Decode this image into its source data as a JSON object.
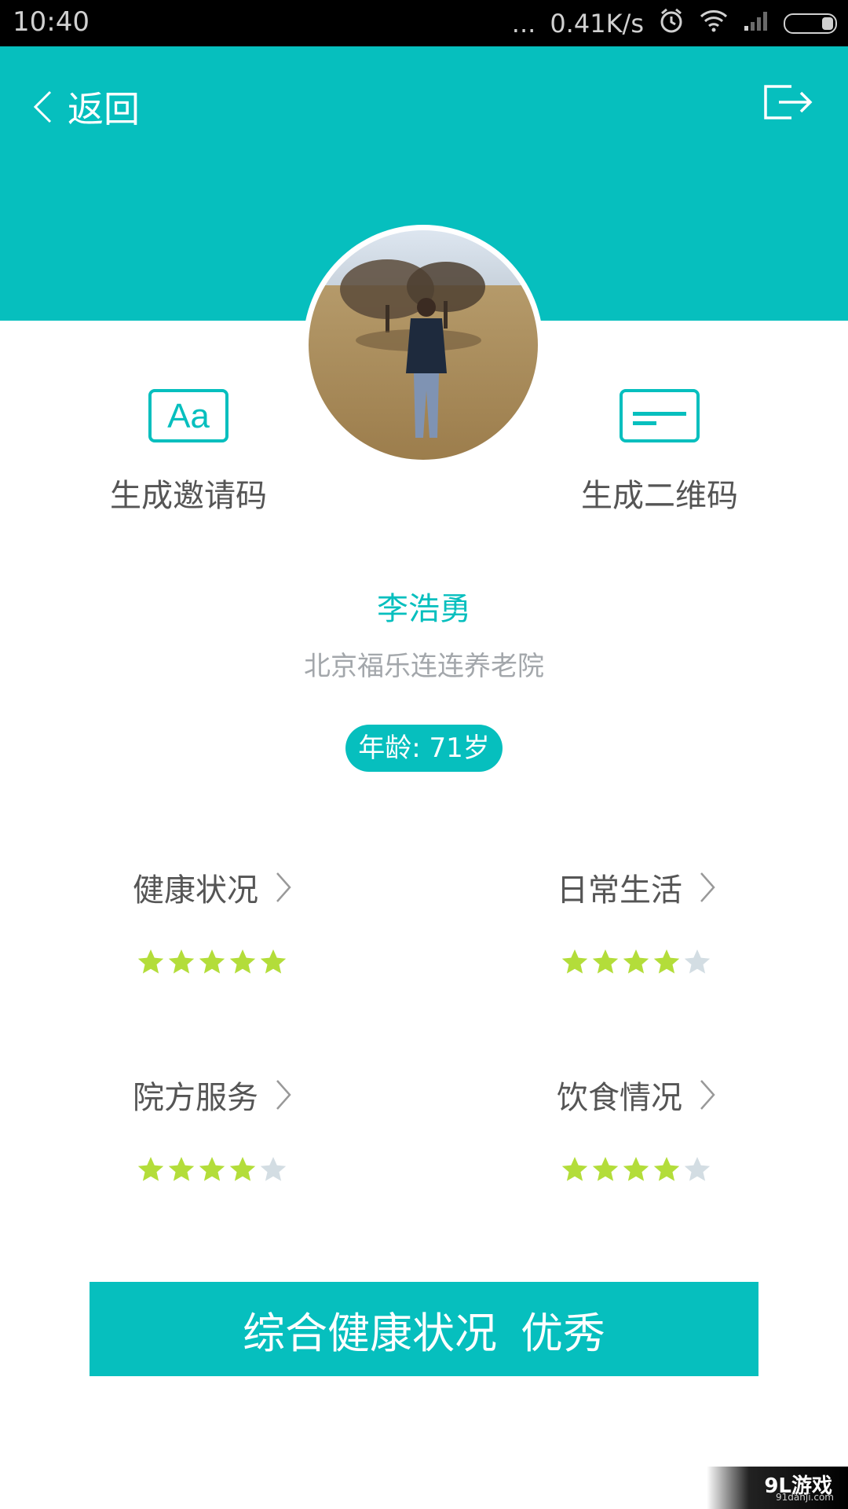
{
  "status_bar": {
    "time": "10:40",
    "dots": "...",
    "speed": "0.41K/s",
    "icons": [
      "alarm-icon",
      "wifi-icon",
      "signal-icon",
      "battery-icon"
    ]
  },
  "header": {
    "back_label": "返回",
    "background_color": "#06bfbe",
    "icons": [
      "chevron-left-icon",
      "logout-icon"
    ]
  },
  "actions": {
    "invite_code_label": "生成邀请码",
    "qr_code_label": "生成二维码",
    "icons": [
      "text-aa-icon",
      "card-icon"
    ]
  },
  "profile": {
    "name": "李浩勇",
    "organization": "北京福乐连连养老院",
    "age_badge": "年龄: 71岁"
  },
  "metrics": [
    {
      "label": "健康状况",
      "rating": 5,
      "max": 5
    },
    {
      "label": "日常生活",
      "rating": 4,
      "max": 5
    },
    {
      "label": "院方服务",
      "rating": 4,
      "max": 5
    },
    {
      "label": "饮食情况",
      "rating": 4,
      "max": 5
    }
  ],
  "summary": {
    "label": "综合健康状况",
    "value": "优秀"
  },
  "watermark": {
    "logo": "9L游戏",
    "url": "91danji.com"
  },
  "colors": {
    "accent": "#06bfbe",
    "star_active": "#b3dd3a",
    "star_inactive": "#d3dde3"
  }
}
